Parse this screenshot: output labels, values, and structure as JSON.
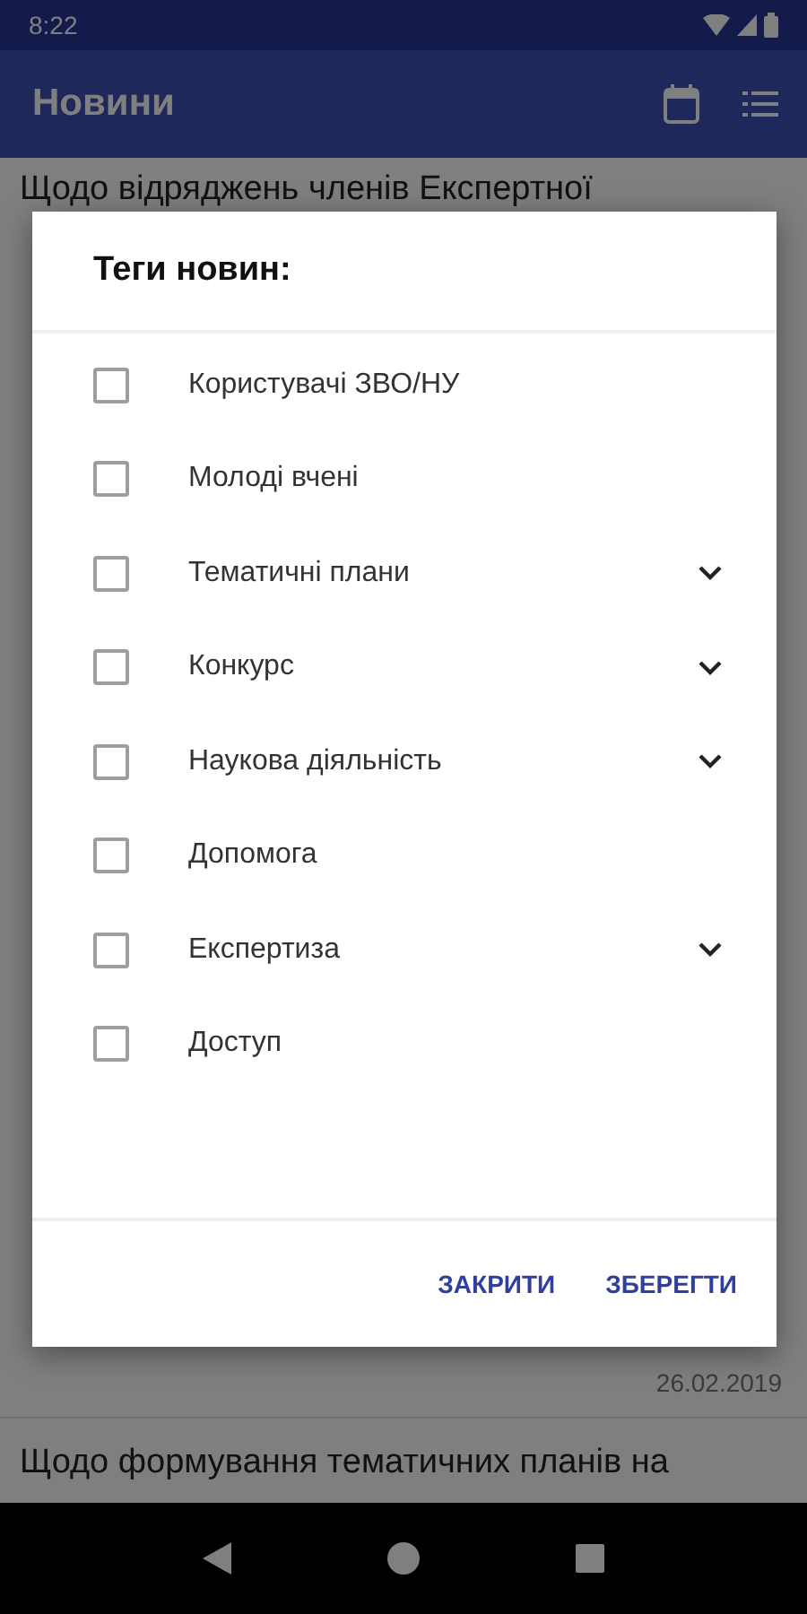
{
  "status_bar": {
    "time": "8:22"
  },
  "app_bar": {
    "title": "Новини"
  },
  "news": [
    {
      "title": "Щодо відряджень членів Експертної"
    },
    {
      "date": "26.02.2019"
    },
    {
      "title": "Щодо формування тематичних планів на"
    }
  ],
  "dialog": {
    "title": "Теги новин:",
    "tags": [
      {
        "label": "Користувачі ЗВО/НУ",
        "checked": false,
        "expandable": false
      },
      {
        "label": "Молоді вчені",
        "checked": false,
        "expandable": false
      },
      {
        "label": "Тематичні плани",
        "checked": false,
        "expandable": true
      },
      {
        "label": "Конкурс",
        "checked": false,
        "expandable": true
      },
      {
        "label": "Наукова діяльність",
        "checked": false,
        "expandable": true
      },
      {
        "label": "Допомога",
        "checked": false,
        "expandable": false
      },
      {
        "label": "Експертиза",
        "checked": false,
        "expandable": true
      },
      {
        "label": "Доступ",
        "checked": false,
        "expandable": false
      }
    ],
    "buttons": [
      "ЗАКРИТИ",
      "ЗБЕРЕГТИ"
    ]
  }
}
